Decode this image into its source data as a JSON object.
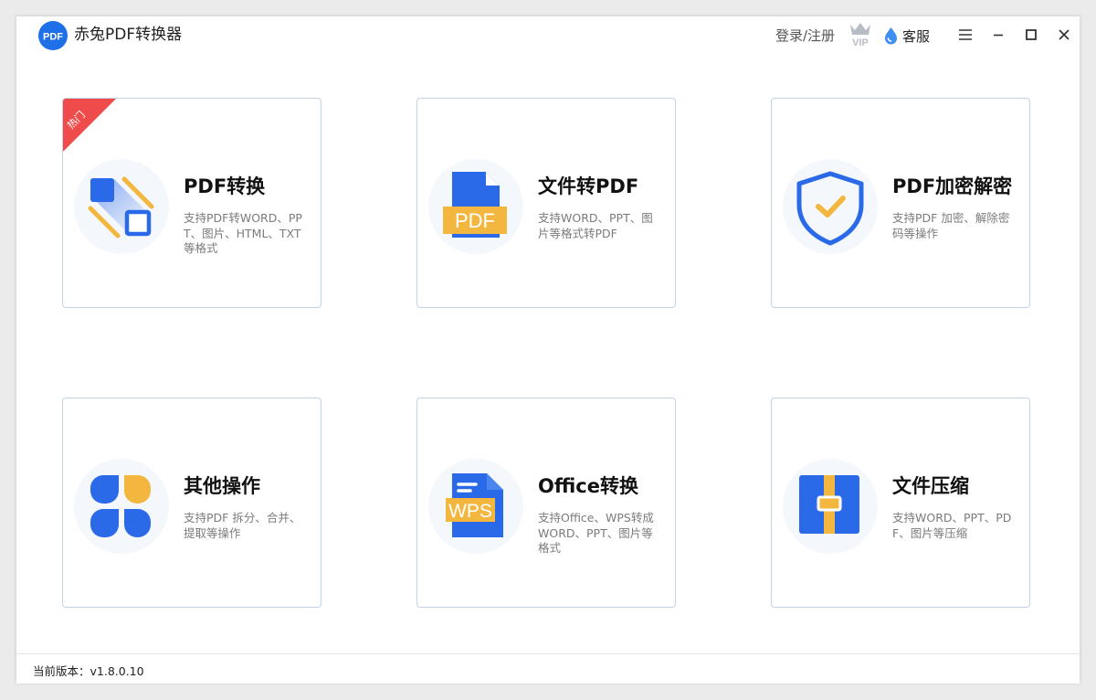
{
  "app": {
    "title": "赤兔PDF转换器",
    "logo_text": "PDF",
    "brand_color": "#1f6fe8"
  },
  "header": {
    "login_label": "登录/注册",
    "vip_label": "VIP",
    "service_label": "客服"
  },
  "window_controls": [
    "menu-icon",
    "minimize-icon",
    "maximize-icon",
    "close-icon"
  ],
  "cards": [
    {
      "title": "PDF转换",
      "desc": "支持PDF转WORD、PPT、图片、HTML、TXT等格式",
      "badge": "热门",
      "icon": "pdf-convert-icon"
    },
    {
      "title": "文件转PDF",
      "desc": "支持WORD、PPT、图片等格式转PDF",
      "icon": "file-to-pdf-icon",
      "icon_text": "PDF"
    },
    {
      "title": "PDF加密解密",
      "desc": "支持PDF 加密、解除密码等操作",
      "icon": "shield-check-icon"
    },
    {
      "title": "其他操作",
      "desc": "支持PDF 拆分、合并、提取等操作",
      "icon": "four-leaf-icon"
    },
    {
      "title": "Office转换",
      "desc": "支持Office、WPS转成WORD、PPT、图片等格式",
      "icon": "wps-doc-icon",
      "icon_text": "WPS"
    },
    {
      "title": "文件压缩",
      "desc": "支持WORD、PPT、PDF、图片等压缩",
      "icon": "compress-zip-icon"
    }
  ],
  "colors": {
    "accent_blue": "#2a6ae9",
    "accent_yellow": "#f3b73f",
    "hot_red": "#f04b4b",
    "card_border": "#c3d3ea"
  },
  "footer": {
    "version_label": "当前版本：v1.8.0.10"
  }
}
